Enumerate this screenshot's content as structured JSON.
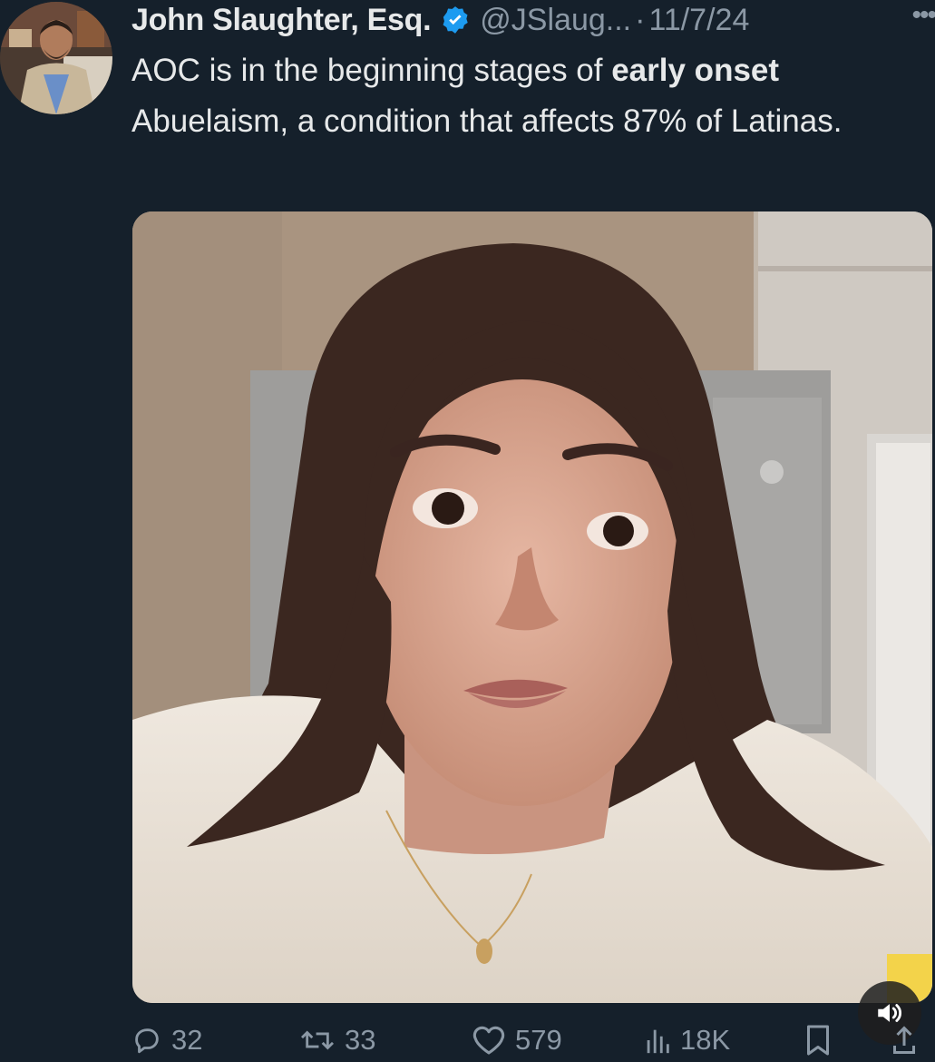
{
  "tweet": {
    "author_name": "John Slaughter, Esq.",
    "handle": "@JSlaug...",
    "separator": "·",
    "date": "11/7/24",
    "more_label": "•••",
    "text_before_bold": "AOC is in the beginning stages of ",
    "text_bold": "early onset",
    "text_after_bold": " Abuelaism, a condition that affects 87% of Latinas."
  },
  "actions": {
    "replies": "32",
    "retweets": "33",
    "likes": "579",
    "views": "18K"
  },
  "icons": {
    "verified": "verified-badge-icon",
    "reply": "reply-icon",
    "retweet": "retweet-icon",
    "like": "heart-icon",
    "views": "views-chart-icon",
    "bookmark": "bookmark-icon",
    "share": "share-icon",
    "sound": "speaker-icon"
  },
  "colors": {
    "background": "#15202b",
    "text": "#e7e9ea",
    "secondary": "#8b98a5",
    "verified": "#1d9bf0"
  }
}
